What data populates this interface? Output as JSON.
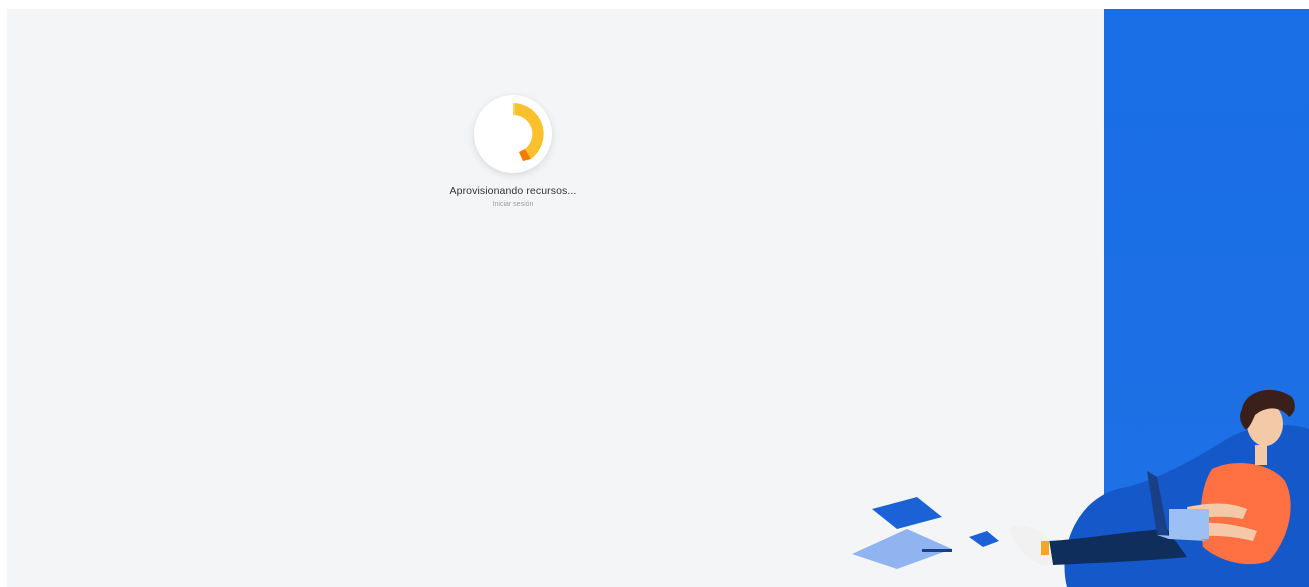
{
  "loader": {
    "status": "Aprovisionando recursos...",
    "subtitle": "Iniciar sesión",
    "icon": "spinner-icon"
  },
  "illustration": {
    "icon": "person-with-laptop-illustration"
  },
  "colors": {
    "background": "#f4f5f7",
    "panel": "#1a6ee6",
    "spinner_primary": "#fbc02d",
    "spinner_secondary": "#f57c00"
  }
}
